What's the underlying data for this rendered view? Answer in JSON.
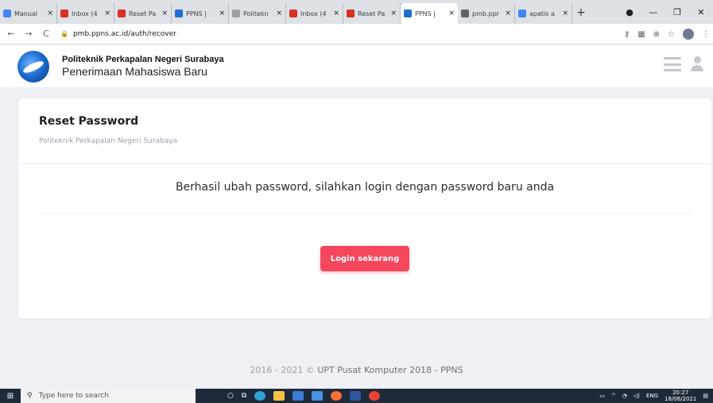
{
  "browser": {
    "tabs": [
      {
        "label": "Manual",
        "color": "#4285f4",
        "active": false
      },
      {
        "label": "Inbox (4",
        "color": "#d93025",
        "active": false
      },
      {
        "label": "Reset Pa",
        "color": "#d93025",
        "active": false
      },
      {
        "label": "PPNS |",
        "color": "#1f6fd1",
        "active": false
      },
      {
        "label": "Politekn",
        "color": "#9aa0a6",
        "active": false
      },
      {
        "label": "Inbox (4",
        "color": "#d93025",
        "active": false
      },
      {
        "label": "Reset Pa",
        "color": "#d93025",
        "active": false
      },
      {
        "label": "PPNS |",
        "color": "#1f6fd1",
        "active": true
      },
      {
        "label": "pmb.ppr",
        "color": "#5f6368",
        "active": false
      },
      {
        "label": "apatis a",
        "color": "#4285f4",
        "active": false
      }
    ],
    "tab_close": "×",
    "new_tab": "+",
    "url": "pmb.ppns.ac.id/auth/recover"
  },
  "site": {
    "name": "Politeknik Perkapalan Negeri Surabaya",
    "subtitle": "Penerimaan Mahasiswa Baru"
  },
  "card": {
    "title": "Reset Password",
    "subtitle": "Politeknik Perkapalan Negeri Surabaya",
    "message": "Berhasil ubah password, silahkan login dengan password baru anda",
    "button_label": "Login sekarang",
    "button_color": "#f5475c"
  },
  "footer": {
    "years": "2016 - 2021 ©",
    "text": "UPT Pusat Komputer 2018 - PPNS"
  },
  "taskbar": {
    "search_placeholder": "Type here to search",
    "lang": "ENG",
    "time": "20:27",
    "date": "18/06/2021"
  }
}
